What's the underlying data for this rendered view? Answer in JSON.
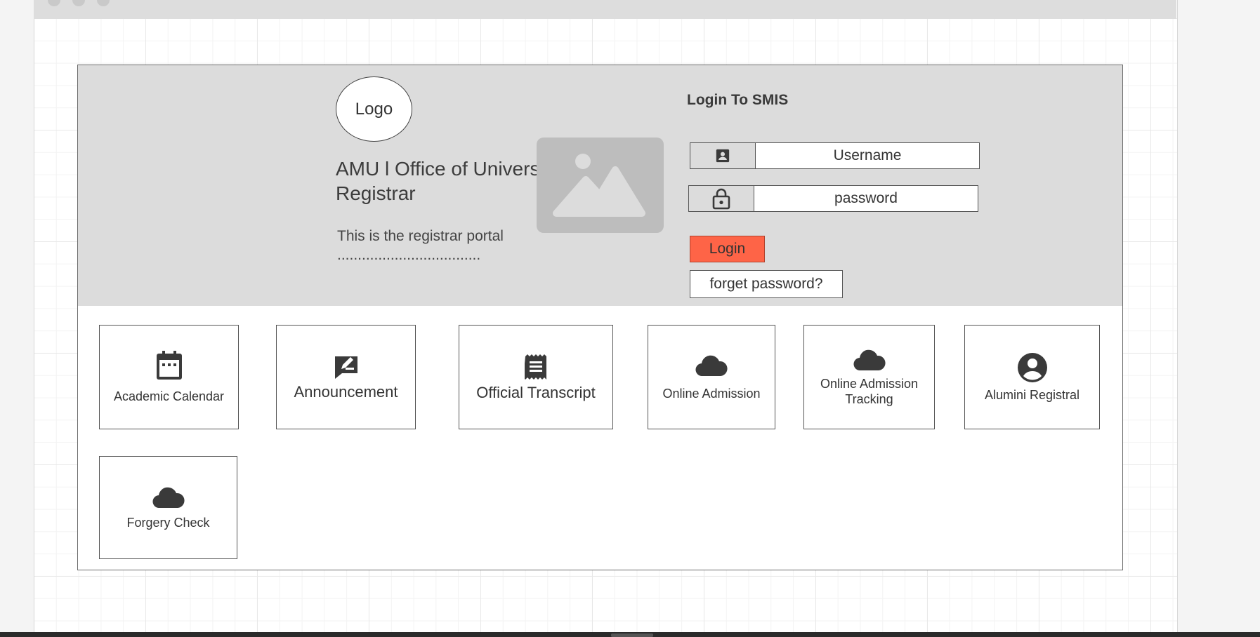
{
  "header": {
    "logo_label": "Logo",
    "org_title": "AMU l Office of University Registrar",
    "portal_description": "This is the registrar portal ..................................."
  },
  "login": {
    "heading": "Login To SMIS",
    "username_placeholder": "Username",
    "password_placeholder": "password",
    "login_button": "Login",
    "forgot_button": "forget password?"
  },
  "tiles": [
    {
      "label": "Academic Calendar",
      "icon": "calendar-icon"
    },
    {
      "label": "Announcement",
      "icon": "edit-note-icon"
    },
    {
      "label": "Official Transcript",
      "icon": "receipt-icon"
    },
    {
      "label": "Online Admission",
      "icon": "cloud-icon"
    },
    {
      "label": "Online Admission Tracking",
      "icon": "cloud-icon"
    },
    {
      "label": "Alumini Registral",
      "icon": "account-circle-icon"
    },
    {
      "label": "Forgery Check",
      "icon": "cloud-icon"
    }
  ],
  "colors": {
    "hero_background": "#dcdcdc",
    "login_button": "#fe6447",
    "icon": "#3a3a3a"
  }
}
